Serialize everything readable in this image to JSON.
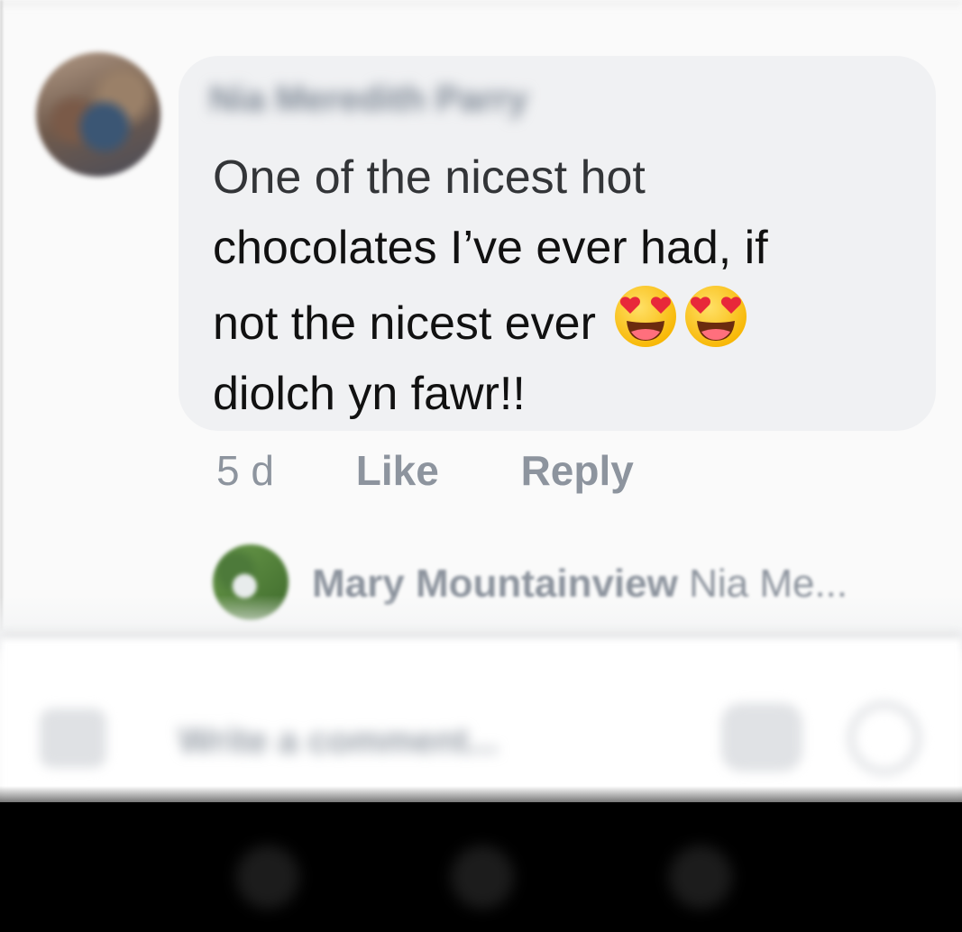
{
  "comment": {
    "author": "Nia Meredith Parry",
    "text_lines": [
      "One of the nicest hot",
      "chocolates I’ve ever had, if",
      "not the nicest ever",
      "diolch yn fawr!!"
    ],
    "emoji": [
      "heart-eyes-emoji",
      "heart-eyes-emoji"
    ],
    "timestamp": "5 d",
    "like_label": "Like",
    "reply_label": "Reply"
  },
  "reply_preview": {
    "author": "Mary Mountainview",
    "snippet": "Nia Me..."
  },
  "composer": {
    "placeholder": "Write a comment..."
  },
  "colors": {
    "bubble": "#f0f1f3",
    "action_text": "#8d949e",
    "comment_text": "#111111"
  }
}
